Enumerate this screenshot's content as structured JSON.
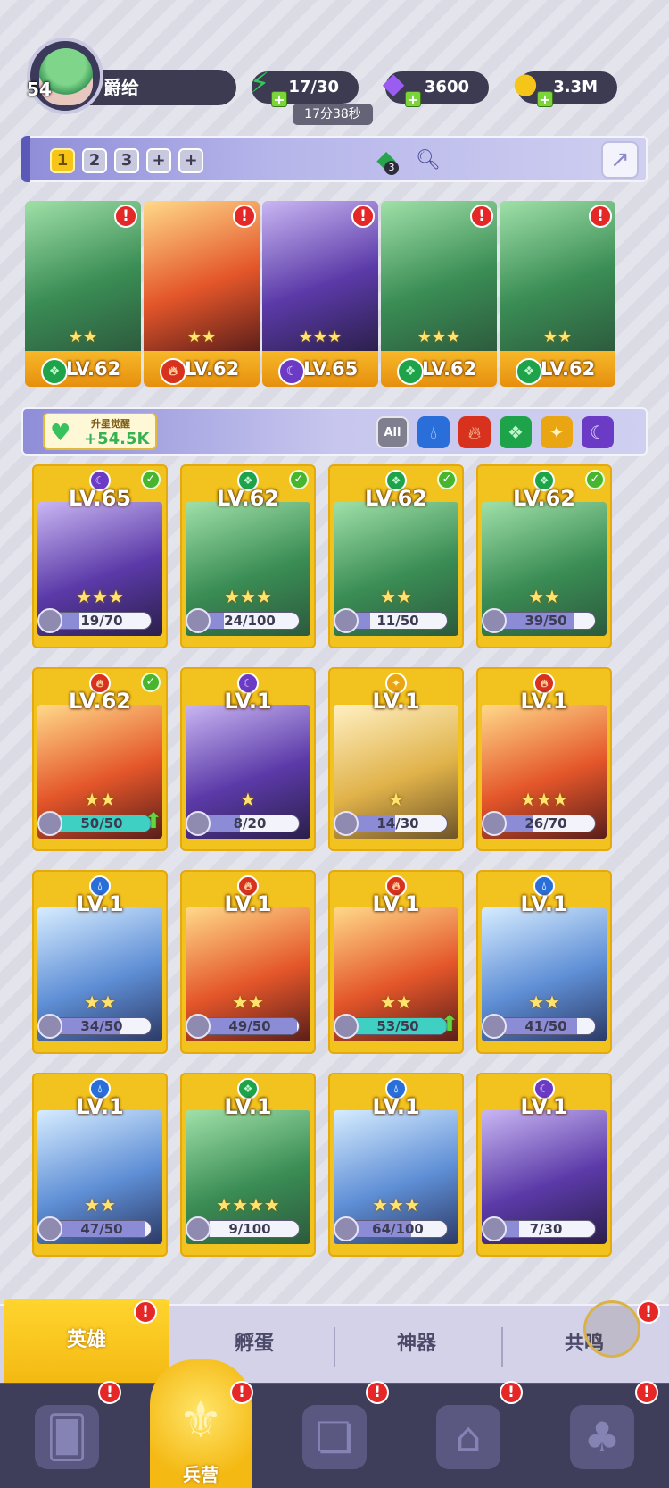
{
  "player": {
    "level": "54",
    "name": "爵给"
  },
  "resources": {
    "energy": "17/30",
    "energy_timer": "17分38秒",
    "gems": "3600",
    "gold": "3.3M"
  },
  "team_bar": {
    "slots": [
      "1",
      "2",
      "3",
      "+",
      "+"
    ],
    "gem_count": "3"
  },
  "team": [
    {
      "element": "green",
      "stars": "★★",
      "level": "LV.62",
      "alert": "!"
    },
    {
      "element": "red",
      "stars": "★★",
      "level": "LV.62",
      "alert": "!"
    },
    {
      "element": "purple",
      "stars": "★★★",
      "level": "LV.65",
      "alert": "!"
    },
    {
      "element": "green",
      "stars": "★★★",
      "level": "LV.62",
      "alert": "!"
    },
    {
      "element": "green",
      "stars": "★★",
      "level": "LV.62",
      "alert": "!"
    }
  ],
  "awaken": {
    "label": "升星觉醒",
    "value": "+54.5K"
  },
  "filters": {
    "all": "All"
  },
  "heroes": [
    {
      "element": "purple",
      "level": "LV.65",
      "stars": "★★★",
      "progress": "19/70",
      "ratio": 0.27,
      "checked": true
    },
    {
      "element": "green",
      "level": "LV.62",
      "stars": "★★★",
      "progress": "24/100",
      "ratio": 0.24,
      "checked": true
    },
    {
      "element": "green",
      "level": "LV.62",
      "stars": "★★",
      "progress": "11/50",
      "ratio": 0.22,
      "checked": true
    },
    {
      "element": "green",
      "level": "LV.62",
      "stars": "★★",
      "progress": "39/50",
      "ratio": 0.78,
      "checked": true
    },
    {
      "element": "red",
      "level": "LV.62",
      "stars": "★★",
      "progress": "50/50",
      "ratio": 1.0,
      "checked": true,
      "upgrade": true
    },
    {
      "element": "purple",
      "level": "LV.1",
      "stars": "★",
      "progress": "8/20",
      "ratio": 0.4
    },
    {
      "element": "gold",
      "level": "LV.1",
      "stars": "★",
      "progress": "14/30",
      "ratio": 0.47
    },
    {
      "element": "red",
      "level": "LV.1",
      "stars": "★★★",
      "progress": "26/70",
      "ratio": 0.37
    },
    {
      "element": "blue",
      "level": "LV.1",
      "stars": "★★",
      "progress": "34/50",
      "ratio": 0.68
    },
    {
      "element": "red",
      "level": "LV.1",
      "stars": "★★",
      "progress": "49/50",
      "ratio": 0.98
    },
    {
      "element": "red",
      "level": "LV.1",
      "stars": "★★",
      "progress": "53/50",
      "ratio": 1.0,
      "upgrade": true
    },
    {
      "element": "blue",
      "level": "LV.1",
      "stars": "★★",
      "progress": "41/50",
      "ratio": 0.82
    },
    {
      "element": "blue",
      "level": "LV.1",
      "stars": "★★",
      "progress": "47/50",
      "ratio": 0.94
    },
    {
      "element": "green",
      "level": "LV.1",
      "stars": "★★★★",
      "progress": "9/100",
      "ratio": 0.09
    },
    {
      "element": "blue",
      "level": "LV.1",
      "stars": "★★★",
      "progress": "64/100",
      "ratio": 0.64
    },
    {
      "element": "purple",
      "level": "LV.1",
      "stars": "",
      "progress": "7/30",
      "ratio": 0.23
    }
  ],
  "subtabs": {
    "heroes": "英雄",
    "hatch": "孵蛋",
    "artifacts": "神器",
    "resonance": "共鸣"
  },
  "nav": {
    "barracks": "兵营"
  },
  "alert_mark": "!",
  "colors": {
    "accent": "#f4b913",
    "panel": "#3c3b52"
  }
}
